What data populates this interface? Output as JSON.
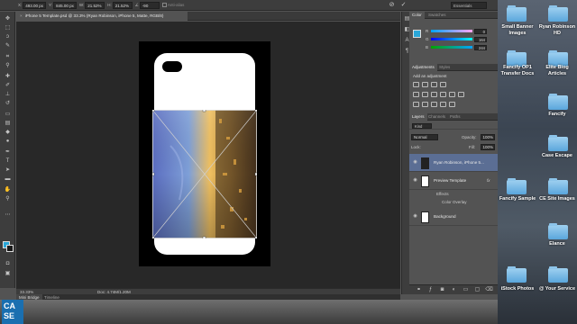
{
  "app": {
    "document_tab": "iPhone 5 Template.psd @ 33.3% (Ryan Robinson, iPhone 5, Matte, RGB/8)",
    "tab_close": "×",
    "zoom_level": "33.33%",
    "doc_size": "Doc: 4.74M/1.20M",
    "workspace": "Essentials"
  },
  "options_bar": {
    "x_label": "X:",
    "x_value": "493.00 px",
    "y_label": "Y:",
    "y_value": "845.00 px",
    "w_label": "W:",
    "w_value": "21.52%",
    "h_label": "H:",
    "h_value": "21.52%",
    "angle_label": "∠",
    "angle_value": "-90",
    "antialias_label": "Anti-alias",
    "cancel_glyph": "⊘",
    "commit_glyph": "✓"
  },
  "bottom_tabs": [
    "Mini Bridge",
    "Timeline"
  ],
  "color_panel": {
    "tabs": [
      "Color",
      "Swatches"
    ],
    "swatch_color": "#2aa7d8",
    "channels": [
      {
        "label": "R",
        "value": "0"
      },
      {
        "label": "G",
        "value": "164"
      },
      {
        "label": "B",
        "value": "244"
      }
    ]
  },
  "adjustments_panel": {
    "tabs": [
      "Adjustments",
      "Styles"
    ],
    "title": "Add an adjustment"
  },
  "layers_panel": {
    "tabs": [
      "Layers",
      "Channels",
      "Paths"
    ],
    "kind": "Kind",
    "blend_mode": "Normal",
    "opacity_label": "Opacity:",
    "opacity_value": "100%",
    "lock_label": "Lock:",
    "fill_label": "Fill:",
    "fill_value": "100%",
    "layers": [
      {
        "name": "Ryan Robinson, iPhone 5...",
        "fx": ""
      },
      {
        "name": "Preview Template",
        "fx": "fx"
      },
      {
        "name": "Background",
        "fx": ""
      }
    ],
    "effects_label": "Effects",
    "color_overlay_label": "Color Overlay"
  },
  "desktop": {
    "items": [
      {
        "label": "Small Banner Images"
      },
      {
        "label": "Ryan Robinson HD"
      },
      {
        "label": "Fancify OP1 Transfer Docs"
      },
      {
        "label": "Elite Blog Articles"
      },
      {
        "label": "Fancify"
      },
      {
        "label": "Case Escape"
      },
      {
        "label": "Fancify Sample"
      },
      {
        "label": "CE Site Images"
      },
      {
        "label": "Elance"
      },
      {
        "label": "iStock Photos"
      },
      {
        "label": "@ Your Service"
      }
    ]
  }
}
